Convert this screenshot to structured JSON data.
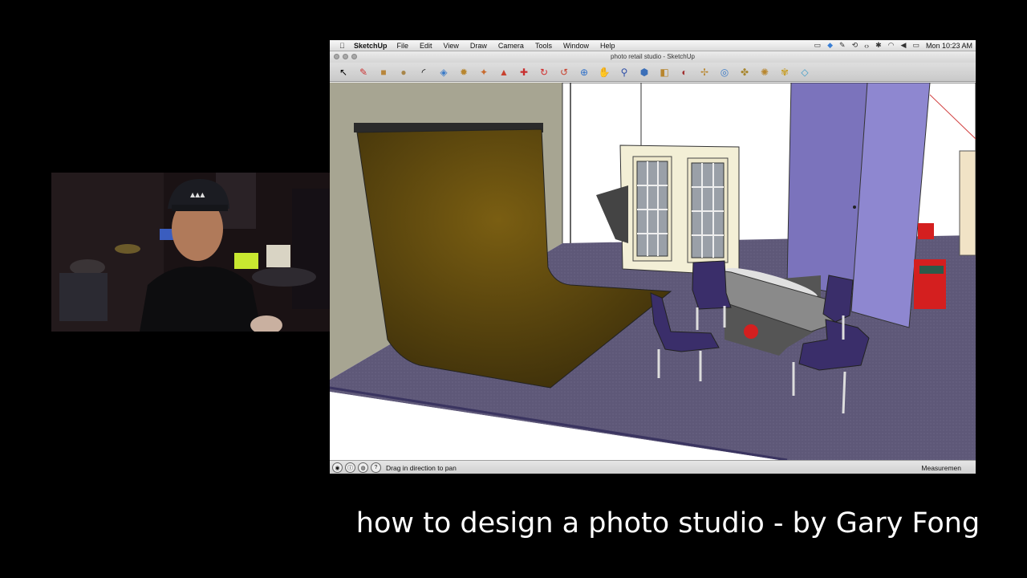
{
  "menubar": {
    "app_name": "SketchUp",
    "items": [
      "File",
      "Edit",
      "View",
      "Draw",
      "Camera",
      "Tools",
      "Window",
      "Help"
    ],
    "clock": "Mon 10:23 AM",
    "status_icons": [
      "video-icon",
      "dropbox-icon",
      "wrench-icon",
      "timemachine-icon",
      "code-icon",
      "bluetooth-icon",
      "wifi-icon",
      "volume-icon",
      "battery-icon"
    ]
  },
  "window": {
    "title": "photo retail studio - SketchUp"
  },
  "toolbar": {
    "tools": [
      "select-icon",
      "pencil-icon",
      "rectangle-icon",
      "circle-icon",
      "arc-icon",
      "make-component-icon",
      "paint-bucket-icon",
      "eraser-icon",
      "push-pull-icon",
      "move-icon",
      "rotate-icon",
      "follow-me-icon",
      "orbit-icon",
      "pan-icon",
      "zoom-icon",
      "zoom-extents-icon",
      "tape-measure-icon",
      "protractor-icon",
      "axes-icon",
      "text-icon",
      "section-icon",
      "walk-icon",
      "position-camera-icon",
      "look-around-icon"
    ]
  },
  "statusbar": {
    "hint": "Drag in direction to pan",
    "measure_label": "Measuremen"
  },
  "caption": "how to design a photo studio - by Gary Fong",
  "colors": {
    "floor": "#5e5878",
    "backdrop": "#6a5210",
    "wall_purple": "#7771b8",
    "left_wall": "#a7a592",
    "table_top": "#888888",
    "chair": "#3a2e6a"
  }
}
